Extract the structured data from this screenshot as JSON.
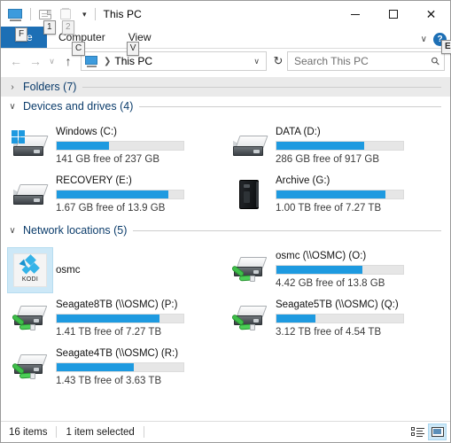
{
  "window": {
    "title": "This PC",
    "quick_access": [
      {
        "name": "monitor-icon",
        "keytip": ""
      },
      {
        "name": "new-folder-icon",
        "keytip": "1"
      },
      {
        "name": "properties-icon",
        "keytip": "2"
      }
    ],
    "qat_dropdown": "▾",
    "controls": {
      "minimize": "–",
      "maximize": "□",
      "close": "✕"
    }
  },
  "ribbon": {
    "tabs": [
      {
        "label": "File",
        "keytip": "F",
        "active": true
      },
      {
        "label": "Computer",
        "keytip": "C",
        "active": false
      },
      {
        "label": "View",
        "keytip": "V",
        "active": false
      }
    ],
    "expand_chevron": "∨",
    "help_label": "?",
    "help_keytip": "E"
  },
  "addressbar": {
    "back": "←",
    "forward": "→",
    "recent": "∨",
    "up": "↑",
    "crumb_icon": "monitor-icon",
    "crumb_separator": "❯",
    "crumb_text": "This PC",
    "crumb_dropdown": "∨",
    "refresh": "↻",
    "search_placeholder": "Search This PC",
    "search_value": "",
    "search_icon": "search-icon"
  },
  "groups": [
    {
      "title": "Folders (7)",
      "expanded": false,
      "chevron": "›",
      "banded": true,
      "items": []
    },
    {
      "title": "Devices and drives (4)",
      "expanded": true,
      "chevron": "∨",
      "banded": false,
      "items": [
        {
          "name": "Windows (C:)",
          "sub": "141 GB free of 237 GB",
          "fill_pct": 41,
          "icon": "windows-drive-icon",
          "selected": false
        },
        {
          "name": "DATA (D:)",
          "sub": "286 GB free of 917 GB",
          "fill_pct": 69,
          "icon": "hard-drive-icon",
          "selected": false
        },
        {
          "name": "RECOVERY (E:)",
          "sub": "1.67 GB free of 13.9 GB",
          "fill_pct": 88,
          "icon": "hard-drive-icon",
          "selected": false
        },
        {
          "name": "Archive (G:)",
          "sub": "1.00 TB free of 7.27 TB",
          "fill_pct": 86,
          "icon": "external-drive-icon",
          "selected": false
        }
      ]
    },
    {
      "title": "Network locations (5)",
      "expanded": true,
      "chevron": "∨",
      "banded": false,
      "items": [
        {
          "name": "osmc",
          "sub": "",
          "fill_pct": null,
          "icon": "kodi-icon",
          "selected": true,
          "icon_text": "KODI"
        },
        {
          "name": "osmc (\\\\OSMC) (O:)",
          "sub": "4.42 GB free of 13.8 GB",
          "fill_pct": 68,
          "icon": "network-drive-icon",
          "selected": false
        },
        {
          "name": "Seagate8TB (\\\\OSMC) (P:)",
          "sub": "1.41 TB free of 7.27 TB",
          "fill_pct": 81,
          "icon": "network-drive-icon",
          "selected": false
        },
        {
          "name": "Seagate5TB (\\\\OSMC) (Q:)",
          "sub": "3.12 TB free of 4.54 TB",
          "fill_pct": 31,
          "icon": "network-drive-icon",
          "selected": false
        },
        {
          "name": "Seagate4TB (\\\\OSMC) (R:)",
          "sub": "1.43 TB free of 3.63 TB",
          "fill_pct": 61,
          "icon": "network-drive-icon",
          "selected": false
        }
      ]
    }
  ],
  "statusbar": {
    "item_count": "16 items",
    "selection": "1 item selected",
    "views": [
      {
        "name": "details-view-button",
        "active": false
      },
      {
        "name": "large-icons-view-button",
        "active": true
      }
    ]
  },
  "colors": {
    "accent": "#1d6fb5",
    "bar_fill": "#1e9ae0",
    "group_title": "#0b3c6b",
    "selection": "#cde8f7"
  }
}
